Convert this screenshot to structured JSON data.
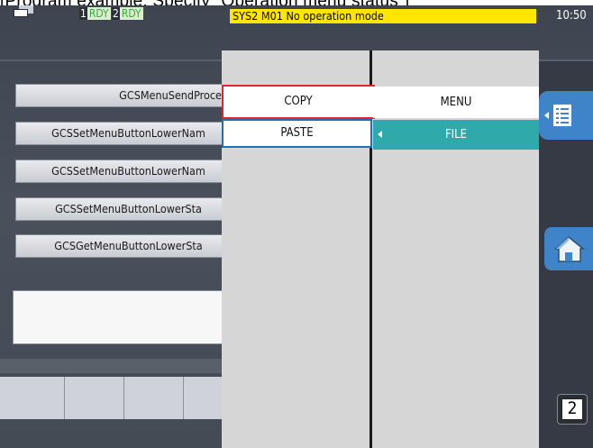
{
  "caption": "[Program example: Specify \"Operation menu status\"]",
  "header": {
    "sys1_number": "1",
    "sys1_status": "RDY",
    "sys2_number": "2",
    "sys2_status": "RDY",
    "status_message": "SYS2 M01  No operation mode",
    "clock": "10:50"
  },
  "left_buttons": [
    "GCSMenuSendProcessI",
    "GCSSetMenuButtonLowerNam",
    "GCSSetMenuButtonLowerNam",
    "GCSSetMenuButtonLowerSta",
    "GCSGetMenuButtonLowerSta"
  ],
  "menu": {
    "copy_label": "COPY",
    "paste_label": "PASTE",
    "tab_menu_label": "MENU",
    "tab_file_label": "FILE"
  },
  "side": {
    "page_number": "2",
    "list_icon": "list-toggle-icon",
    "home_icon": "home-icon"
  },
  "colors": {
    "status_bar": "#ffe600",
    "file_tab": "#2fa9a9",
    "copy_border": "#e0262a",
    "paste_border": "#1f6fb5",
    "side_buttons": "#3f83c9"
  }
}
